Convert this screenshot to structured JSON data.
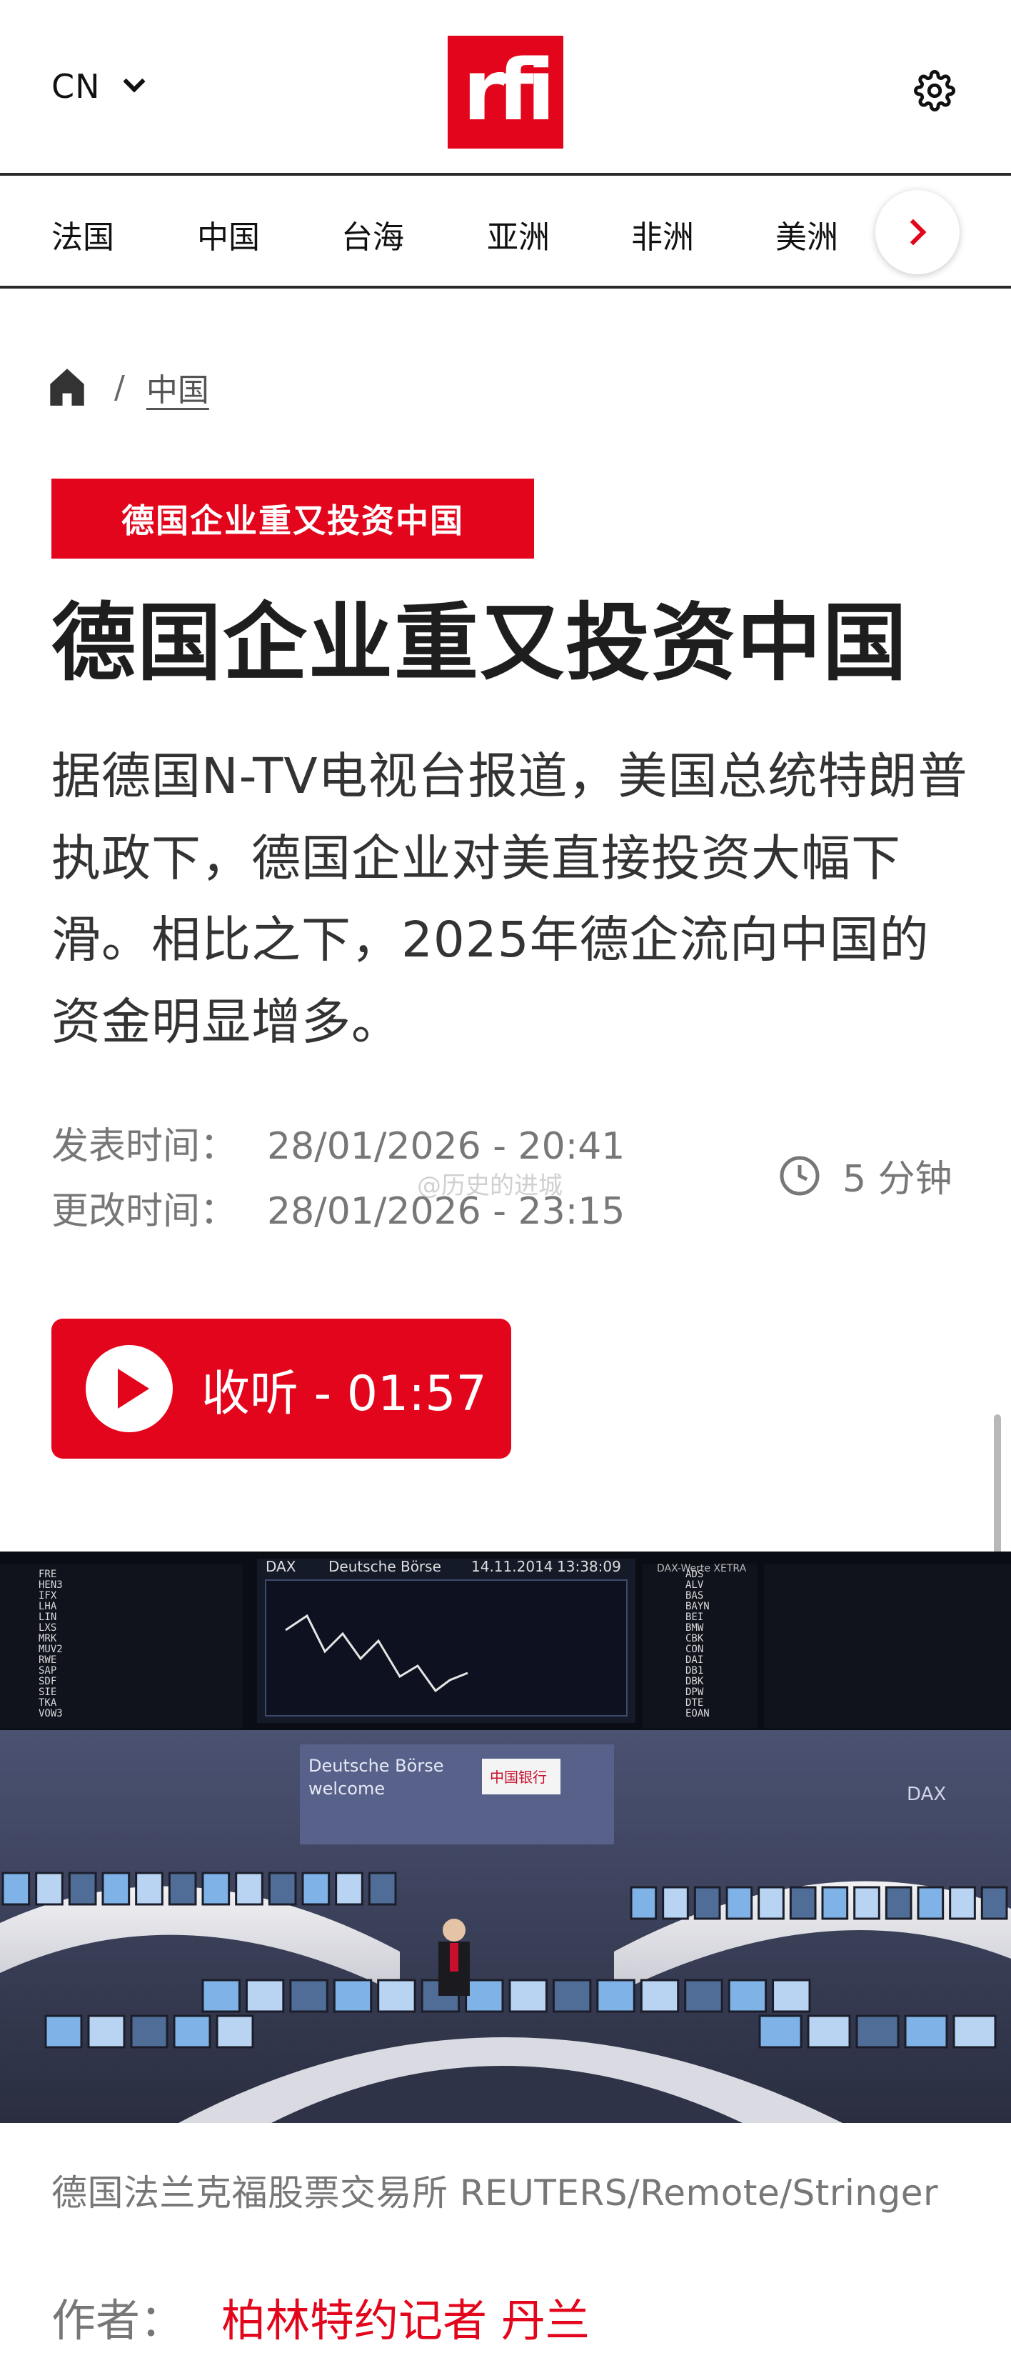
{
  "header": {
    "language": "CN",
    "logo_text": "rfi",
    "brand_color": "#e3051b"
  },
  "nav": {
    "items": [
      "法国",
      "中国",
      "台海",
      "亚洲",
      "非洲",
      "美洲"
    ],
    "faded_item": "洲",
    "next_icon": "chevron-right-icon"
  },
  "breadcrumb": {
    "home_icon": "home-icon",
    "separator": "/",
    "section": "中国"
  },
  "article": {
    "tag": "德国企业重又投资中国",
    "title": "德国企业重又投资中国",
    "lead": "据德国N-TV电视台报道，美国总统特朗普执政下，德国企业对美直接投资大幅下滑。相比之下，2025年德企流向中国的资金明显增多。",
    "published_label": "发表时间：",
    "published": "28/01/2026 - 20:41",
    "updated_label": "更改时间：",
    "updated": "28/01/2026 - 23:15",
    "read_time": "5 分钟",
    "watermark": "@历史的进城",
    "listen_label": "收听 - 01:57",
    "photo": {
      "board_title": "Deutsche Börse",
      "board_date": "14.11.2014",
      "board_time": "13:38:09",
      "board_left_tag": "DAX",
      "board_right_tag": "DAX-Werte XETRA",
      "wall_text_1": "Deutsche Börse",
      "wall_text_2": "welcome",
      "bank_sign": "中国银行",
      "corner_tag": "DAX",
      "tickers_left": [
        "FRE",
        "HEN3",
        "IFX",
        "LHA",
        "LIN",
        "LXS",
        "MRK",
        "MUV2",
        "RWE",
        "SAP",
        "SDF",
        "SIE",
        "TKA",
        "VOW3"
      ],
      "tickers_right": [
        "ADS",
        "ALV",
        "BAS",
        "BAYN",
        "BEI",
        "BMW",
        "CBK",
        "CON",
        "DAI",
        "DB1",
        "DBK",
        "DPW",
        "DTE",
        "EOAN"
      ]
    },
    "caption": "德国法兰克福股票交易所 REUTERS/Remote/Stringer",
    "author_label": "作者：",
    "author": "柏林特约记者 丹兰"
  }
}
